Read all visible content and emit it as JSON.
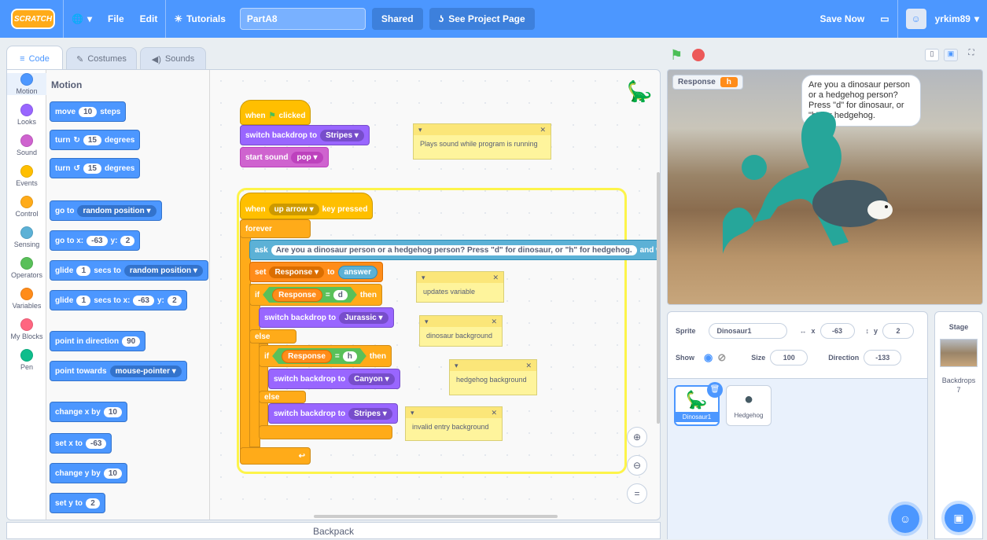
{
  "menubar": {
    "logo": "SCRATCH",
    "file": "File",
    "edit": "Edit",
    "tutorials": "Tutorials",
    "project_title": "PartA8",
    "shared": "Shared",
    "see_project_page": "See Project Page",
    "save_now": "Save Now",
    "username": "yrkim89"
  },
  "tabs": {
    "code": "Code",
    "costumes": "Costumes",
    "sounds": "Sounds"
  },
  "categories": [
    "Motion",
    "Looks",
    "Sound",
    "Events",
    "Control",
    "Sensing",
    "Operators",
    "Variables",
    "My Blocks",
    "Pen"
  ],
  "palette": {
    "title": "Motion",
    "move": "move",
    "move_val": "10",
    "steps": "steps",
    "turn": "turn",
    "turn_val1": "15",
    "degrees": "degrees",
    "turn_val2": "15",
    "goto": "go to",
    "goto_opt": "random position",
    "gotoxy": "go to x:",
    "x_val": "-63",
    "y_lbl": "y:",
    "y_val": "2",
    "glide": "glide",
    "glide_val": "1",
    "secs_to": "secs to",
    "glide_opt": "random position",
    "glide2_val": "1",
    "secs_to_x": "secs to x:",
    "glide2_x": "-63",
    "glide2_y": "2",
    "point_dir": "point in direction",
    "point_dir_val": "90",
    "point_towards": "point towards",
    "point_towards_opt": "mouse-pointer",
    "change_x": "change x by",
    "change_x_val": "10",
    "set_x": "set x to",
    "set_x_val": "-63",
    "change_y": "change y by",
    "change_y_val": "10",
    "set_y": "set y to",
    "set_y_val": "2"
  },
  "script1": {
    "hat": "when",
    "clicked": "clicked",
    "switch_bd": "switch backdrop to",
    "backdrop": "Stripes",
    "start_sound": "start sound",
    "sound": "pop"
  },
  "script2": {
    "when": "when",
    "key": "up arrow",
    "key_pressed": "key pressed",
    "forever": "forever",
    "ask": "ask",
    "question": "Are you a dinosaur person or a hedgehog person? Press \"d\" for dinosaur, or \"h\" for hedgehog.",
    "and_wait": "and wait",
    "set": "set",
    "var": "Response",
    "to": "to",
    "answer": "answer",
    "if": "if",
    "then": "then",
    "eq_var": "Response",
    "eq": "=",
    "d": "d",
    "bd_jurassic_lbl": "switch backdrop to",
    "bd_jurassic": "Jurassic",
    "else": "else",
    "if2": "if",
    "then2": "then",
    "eq_var2": "Response",
    "eq2": "=",
    "h": "h",
    "bd_canyon_lbl": "switch backdrop to",
    "bd_canyon": "Canyon",
    "else2": "else",
    "bd_stripes_lbl": "switch backdrop to",
    "bd_stripes": "Stripes"
  },
  "notes": {
    "n1": "Plays sound while program is running",
    "n2": "updates variable",
    "n3": "dinosaur background",
    "n4": "hedgehog background",
    "n5": "invalid entry background"
  },
  "backpack": "Backpack",
  "stage": {
    "monitor_label": "Response",
    "monitor_value": "h",
    "bubble": "Are you a dinosaur person or a hedgehog person? Press \"d\" for dinosaur, or \"h\" for hedgehog."
  },
  "sprite_info": {
    "sprite_lbl": "Sprite",
    "sprite_name": "Dinosaur1",
    "x_lbl": "x",
    "x": "-63",
    "y_lbl": "y",
    "y": "2",
    "show_lbl": "Show",
    "size_lbl": "Size",
    "size": "100",
    "dir_lbl": "Direction",
    "dir": "-133"
  },
  "sprites": [
    "Dinosaur1",
    "Hedgehog"
  ],
  "stage_pane": {
    "title": "Stage",
    "backdrops": "Backdrops",
    "count": "7"
  },
  "colors": {
    "motion": "#4c97ff",
    "looks": "#9966ff",
    "sound": "#cf63cf",
    "events": "#ffbf00",
    "control": "#ffab19",
    "sensing": "#5cb1d6",
    "operators": "#59c059",
    "variables": "#ff8c1a",
    "myblocks": "#ff6680",
    "pen": "#0fbd8c"
  }
}
